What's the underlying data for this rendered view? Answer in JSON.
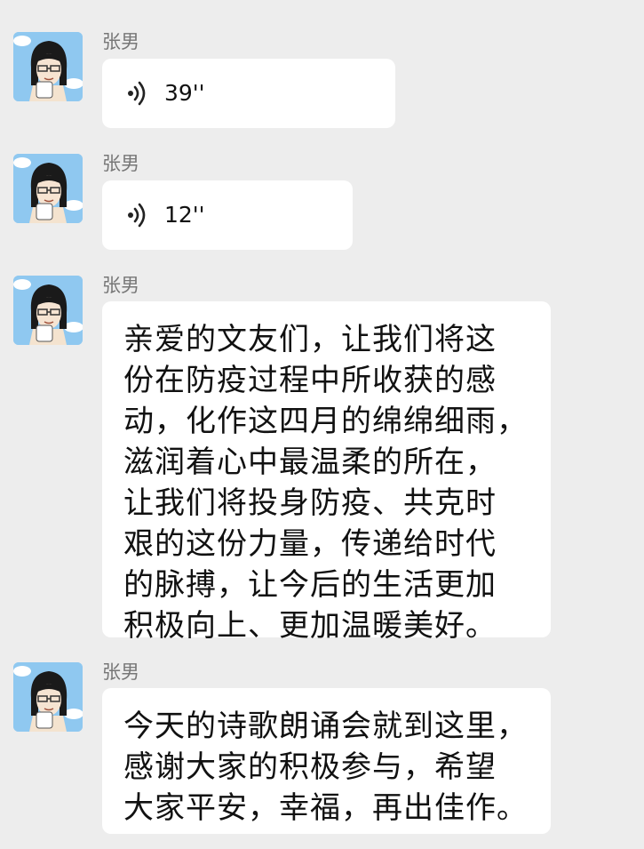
{
  "messages": [
    {
      "sender": "张男",
      "type": "voice",
      "duration": "39''"
    },
    {
      "sender": "张男",
      "type": "voice",
      "duration": "12''"
    },
    {
      "sender": "张男",
      "type": "text",
      "lines": [
        "亲爱的文友们，让我们将这",
        "份在防疫过程中所收获的感",
        "动，化作这四月的绵绵细雨，",
        "滋润着心中最温柔的所在，",
        "让我们将投身防疫、共克时",
        "艰的这份力量，传递给时代",
        "的脉搏，让今后的生活更加",
        "积极向上、更加温暖美好。"
      ]
    },
    {
      "sender": "张男",
      "type": "text",
      "lines": [
        "今天的诗歌朗诵会就到这里，",
        "感谢大家的积极参与，希望",
        "大家平安，幸福，再出佳作。"
      ]
    }
  ],
  "colors": {
    "background": "#ededed",
    "bubble": "#ffffff",
    "sender_name": "#777777",
    "text": "#111111",
    "avatar_sky": "#8fc8f0"
  }
}
